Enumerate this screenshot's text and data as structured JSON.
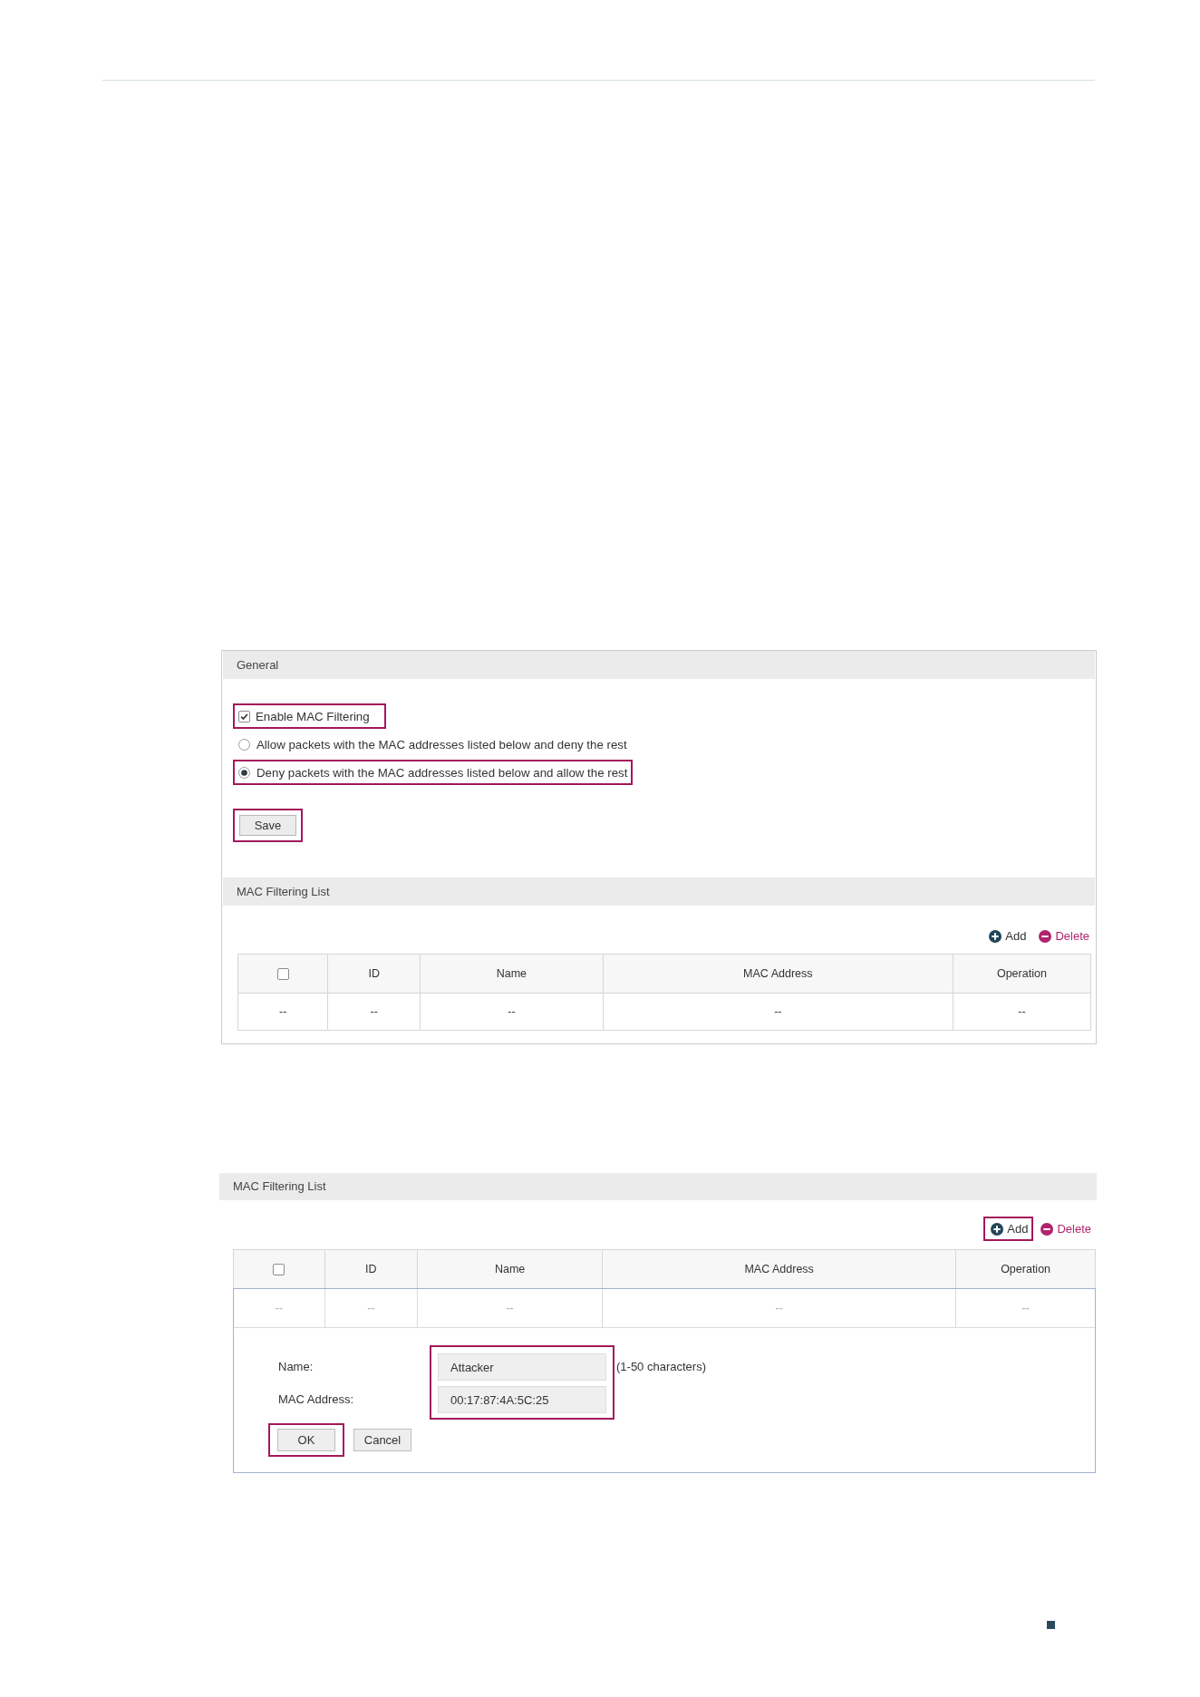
{
  "figure_1": {
    "general": {
      "title": "General",
      "enable": {
        "label": "Enable MAC Filtering",
        "checked": true,
        "highlighted": true
      },
      "modes": [
        {
          "label": "Allow packets with the MAC addresses listed below and deny the rest",
          "selected": false,
          "highlighted": false
        },
        {
          "label": "Deny packets with the MAC addresses listed below and allow the rest",
          "selected": true,
          "highlighted": true
        }
      ],
      "save": {
        "label": "Save",
        "highlighted": true
      }
    },
    "list": {
      "title": "MAC Filtering List",
      "actions": [
        {
          "kind": "add",
          "label": "Add",
          "highlighted": false
        },
        {
          "kind": "delete",
          "label": "Delete",
          "highlighted": false
        }
      ],
      "columns": [
        {
          "kind": "checkbox",
          "checked": false
        },
        {
          "kind": "text",
          "label": "ID"
        },
        {
          "kind": "text",
          "label": "Name"
        },
        {
          "kind": "text",
          "label": "MAC Address"
        },
        {
          "kind": "text",
          "label": "Operation"
        }
      ],
      "rows": [
        {
          "disabled": false,
          "cells": [
            "--",
            "--",
            "--",
            "--",
            "--"
          ]
        }
      ]
    }
  },
  "figure_2": {
    "list": {
      "title": "MAC Filtering List",
      "actions": [
        {
          "kind": "add",
          "label": "Add",
          "highlighted": true
        },
        {
          "kind": "delete",
          "label": "Delete",
          "highlighted": false
        }
      ],
      "columns": [
        {
          "kind": "checkbox",
          "checked": false
        },
        {
          "kind": "text",
          "label": "ID"
        },
        {
          "kind": "text",
          "label": "Name"
        },
        {
          "kind": "text",
          "label": "MAC Address"
        },
        {
          "kind": "text",
          "label": "Operation"
        }
      ],
      "rows": [
        {
          "disabled": true,
          "cells": [
            "--",
            "--",
            "--",
            "--",
            "--"
          ]
        }
      ]
    },
    "form": {
      "fields": [
        {
          "label": "Name:",
          "value": "Attacker",
          "hint": "(1-50 characters)"
        },
        {
          "label": "MAC Address:",
          "value": "00:17:87:4A:5C:25"
        }
      ],
      "fields_highlighted": true,
      "buttons": [
        {
          "label": "OK",
          "highlighted": true
        },
        {
          "label": "Cancel",
          "highlighted": false
        }
      ]
    }
  }
}
